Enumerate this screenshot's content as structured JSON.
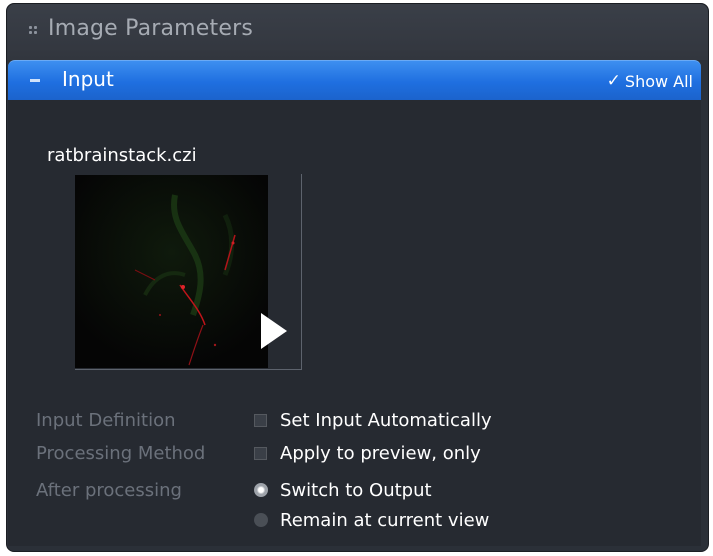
{
  "panel": {
    "title": "Image Parameters"
  },
  "section": {
    "title": "Input",
    "show_all_label": "Show All"
  },
  "image": {
    "file_name": "ratbrainstack.czi"
  },
  "settings": {
    "input_definition": {
      "label": "Input Definition",
      "option": "Set Input Automatically",
      "checked": false
    },
    "processing_method": {
      "label": "Processing Method",
      "option": "Apply to preview, only",
      "checked": false
    },
    "after_processing": {
      "label": "After processing",
      "options": [
        {
          "label": "Switch to Output",
          "selected": true
        },
        {
          "label": "Remain at current view",
          "selected": false
        }
      ]
    }
  },
  "colors": {
    "accent": "#1f6fe0",
    "panel_bg": "#2b3038",
    "label_gray": "#6b717b"
  }
}
